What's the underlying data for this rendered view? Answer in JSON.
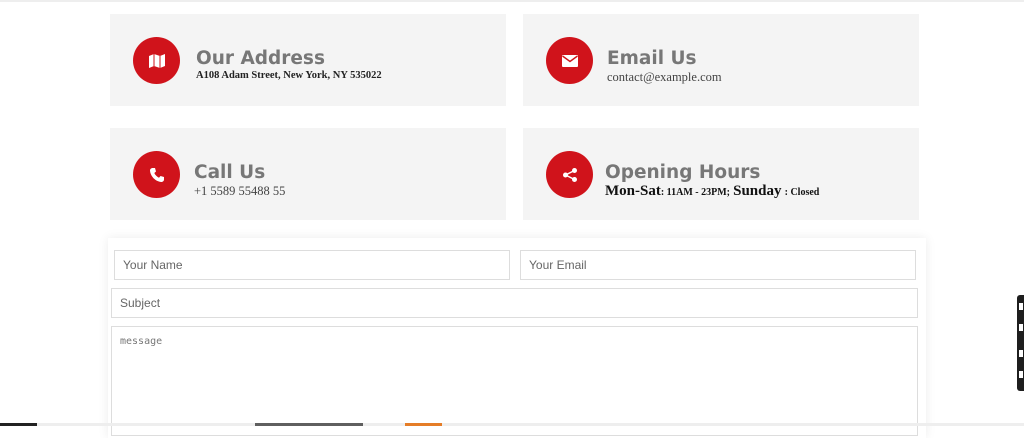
{
  "colors": {
    "accent": "#d0131b",
    "card_bg": "#f4f4f4",
    "title": "#777777"
  },
  "contact_cards": {
    "address": {
      "icon": "map-icon",
      "title": "Our Address",
      "text": "A108 Adam Street, New York, NY 535022"
    },
    "email": {
      "icon": "envelope-icon",
      "title": "Email Us",
      "text": "contact@example.com"
    },
    "phone": {
      "icon": "phone-icon",
      "title": "Call Us",
      "text": "+1 5589 55488 55"
    },
    "hours": {
      "icon": "share-icon",
      "title": "Opening Hours",
      "weekday_label": "Mon-Sat",
      "weekday_time": ": 11AM - 23PM;",
      "weekend_label": "Sunday",
      "weekend_time": ": Closed"
    }
  },
  "form": {
    "name_placeholder": "Your Name",
    "email_placeholder": "Your Email",
    "subject_placeholder": "Subject",
    "message_placeholder": "message"
  }
}
